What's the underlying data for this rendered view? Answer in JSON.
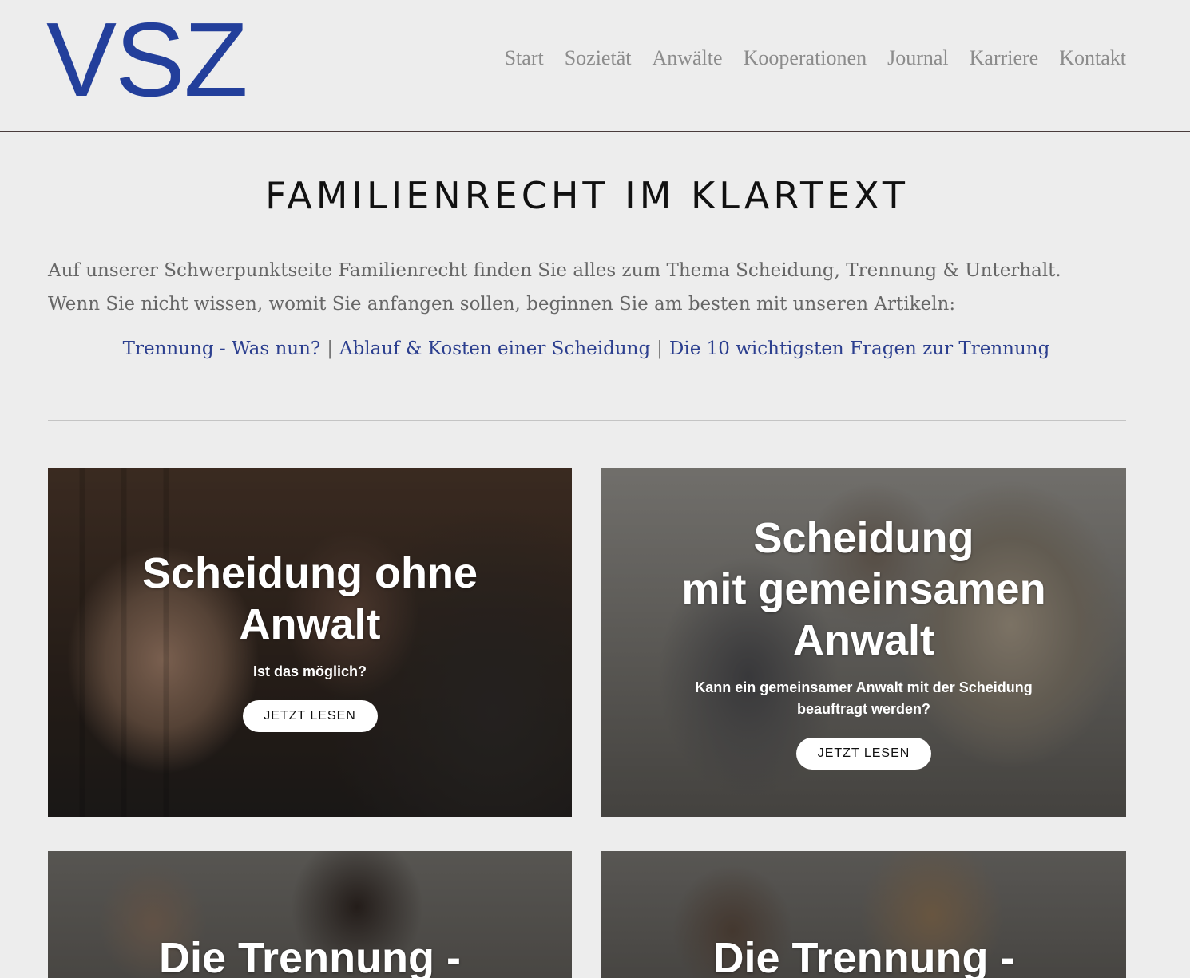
{
  "header": {
    "logo_text": "VSZ",
    "brand_color": "#233f9b",
    "nav": [
      "Start",
      "Sozietät",
      "Anwälte",
      "Kooperationen",
      "Journal",
      "Karriere",
      "Kontakt"
    ]
  },
  "main": {
    "title": "FAMILIENRECHT IM KLARTEXT",
    "intro_line1": "Auf unserer Schwerpunktseite Familienrecht finden Sie alles zum Thema Scheidung, Trennung & Unterhalt.",
    "intro_line2": "Wenn Sie nicht wissen, womit Sie anfangen sollen, beginnen Sie am besten mit unseren Artikeln:",
    "links": [
      "Trennung - Was nun?",
      "Ablauf & Kosten einer Scheidung",
      "Die 10 wichtigsten Fragen zur Trennung"
    ],
    "link_separator": "|",
    "link_color": "#2c3f8f"
  },
  "cards": [
    {
      "title_line1": "Scheidung ohne",
      "title_line2": "Anwalt",
      "subtitle": "Ist das möglich?",
      "button": "JETZT LESEN"
    },
    {
      "title_line1": "Scheidung",
      "title_line2": "mit gemeinsamen",
      "title_line3": "Anwalt",
      "subtitle_line1": "Kann ein gemeinsamer Anwalt mit der Scheidung",
      "subtitle_line2": "beauftragt werden?",
      "button": "JETZT LESEN"
    },
    {
      "title_line1": "Die Trennung -"
    },
    {
      "title_line1": "Die Trennung -"
    }
  ]
}
